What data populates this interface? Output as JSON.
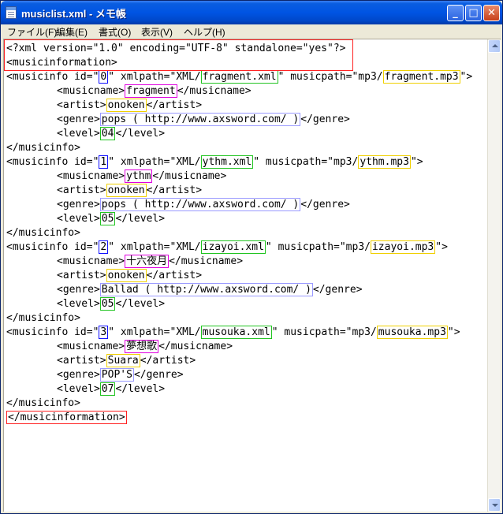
{
  "window": {
    "title": "musiclist.xml - メモ帳",
    "buttons": {
      "minimize": "_",
      "maximize": "□",
      "close": "✕"
    },
    "accent_color": "#0054e3"
  },
  "menu": [
    "ファイル(F)",
    "編集(E)",
    "書式(O)",
    "表示(V)",
    "ヘルプ(H)"
  ],
  "xml": {
    "declaration": "<?xml version=\"1.0\" encoding=\"UTF-8\" standalone=\"yes\"?>",
    "root_open": "<musicinformation>",
    "root_close": "</musicinformation>",
    "info_open_prefix": "<musicinfo id=\"",
    "xmlpath_prefix": "\" xmlpath=\"XML/",
    "musicpath_prefix": "\" musicpath=\"mp3/",
    "musicpath_suffix": "\">",
    "info_close": "</musicinfo>",
    "musicname_open": "<musicname>",
    "musicname_close": "</musicname>",
    "artist_open": "<artist>",
    "artist_close": "</artist>",
    "genre_open": "<genre>",
    "genre_close": "</genre>",
    "level_open": "<level>",
    "level_close": "</level>",
    "entries": [
      {
        "id": "0",
        "xmlpath": "fragment.xml",
        "musicpath": "fragment.mp3",
        "musicname": "fragment",
        "artist": "onoken",
        "genre": "pops ( http://www.axsword.com/ )",
        "level": "04"
      },
      {
        "id": "1",
        "xmlpath": "ythm.xml",
        "musicpath": "ythm.mp3",
        "musicname": "ythm",
        "artist": "onoken",
        "genre": "pops ( http://www.axsword.com/ )",
        "level": "05"
      },
      {
        "id": "2",
        "xmlpath": "izayoi.xml",
        "musicpath": "izayoi.mp3",
        "musicname": "十六夜月",
        "artist": "onoken",
        "genre": "Ballad ( http://www.axsword.com/ )",
        "level": "05"
      },
      {
        "id": "3",
        "xmlpath": "musouka.xml",
        "musicpath": "musouka.mp3",
        "musicname": "夢想歌",
        "artist": "Suara",
        "genre": "POP'S",
        "level": "07"
      }
    ]
  },
  "highlight_colors": {
    "id": "#1010ff",
    "xmlpath": "#21c421",
    "musicpath": "#f0d000",
    "musicname": "#e000e0",
    "artist": "#f0d000",
    "genre": "#9a9aff",
    "level": "#21c421",
    "root": "#ff2020"
  }
}
